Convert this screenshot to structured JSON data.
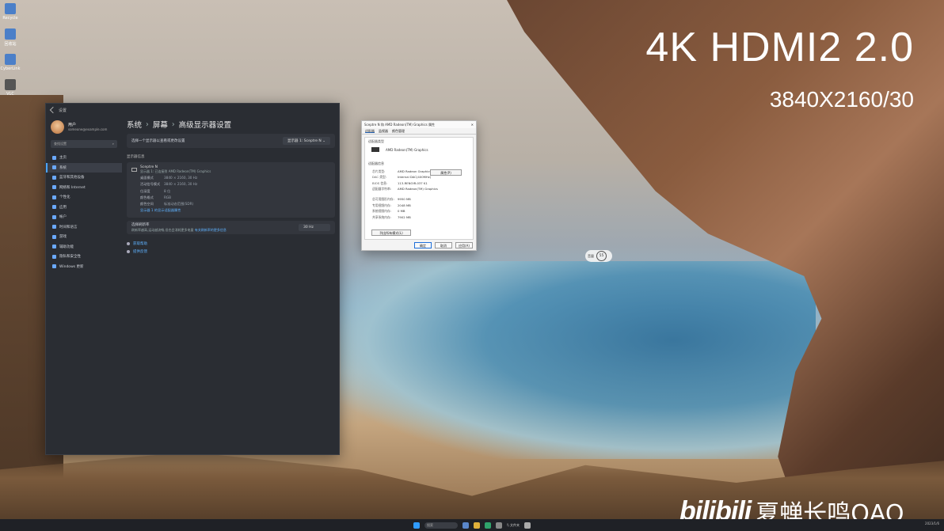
{
  "desktop": {
    "icons": [
      {
        "label": "Recycle",
        "icon": "recycle-bin-icon"
      },
      {
        "label": "回收站",
        "icon": "app-icon"
      },
      {
        "label": "CyberLink",
        "icon": "app-icon"
      },
      {
        "label": "VLC",
        "icon": "app-icon"
      }
    ]
  },
  "overlay": {
    "title": "4K HDMI2 2.0",
    "subtitle": "3840X2160/30",
    "watermark_logo": "bilibili",
    "watermark_name": "夏蝉长鸣QAQ"
  },
  "settings": {
    "window_title": "设置",
    "user": {
      "name": "用户",
      "email": "someone@example.com"
    },
    "find_placeholder": "查找设置",
    "nav": [
      {
        "label": "主页",
        "icon": "home-icon",
        "active": false
      },
      {
        "label": "系统",
        "icon": "system-icon",
        "active": true
      },
      {
        "label": "蓝牙和其他设备",
        "icon": "bluetooth-icon",
        "active": false
      },
      {
        "label": "网络和 Internet",
        "icon": "network-icon",
        "active": false
      },
      {
        "label": "个性化",
        "icon": "brush-icon",
        "active": false
      },
      {
        "label": "应用",
        "icon": "apps-icon",
        "active": false
      },
      {
        "label": "帐户",
        "icon": "account-icon",
        "active": false
      },
      {
        "label": "时间和语言",
        "icon": "clock-icon",
        "active": false
      },
      {
        "label": "游戏",
        "icon": "game-icon",
        "active": false
      },
      {
        "label": "辅助功能",
        "icon": "accessibility-icon",
        "active": false
      },
      {
        "label": "隐私和安全性",
        "icon": "shield-icon",
        "active": false
      },
      {
        "label": "Windows 更新",
        "icon": "update-icon",
        "active": false
      }
    ],
    "breadcrumb": [
      "系统",
      "屏幕",
      "高级显示器设置"
    ],
    "select_display_label": "选择一个显示器以查看或更改设置",
    "select_display_value": "显示器 1: Sceptre N",
    "display_info_heading": "显示器信息",
    "display_name": "Sceptre N",
    "display_sub": "显示器 1: 已连接到 AMD Radeon(TM) Graphics",
    "details": [
      {
        "k": "桌面模式",
        "v": "3840 × 2160, 30 Hz"
      },
      {
        "k": "活动信号模式",
        "v": "3840 × 2160, 30 Hz"
      },
      {
        "k": "位深度",
        "v": "8 位"
      },
      {
        "k": "颜色格式",
        "v": "RGB"
      },
      {
        "k": "颜色空间",
        "v": "标准动态范围(SDR)"
      }
    ],
    "adapter_link": "显示器 1 的显示适配器属性",
    "refresh_label": "选择刷新率",
    "refresh_desc": "刷新率越高,运动越流畅,但也会消耗更多电量",
    "refresh_link": "有关刷新率的更多信息",
    "refresh_value": "30 Hz",
    "help": [
      "获取帮助",
      "提供反馈"
    ]
  },
  "dialog": {
    "title": "Sceptre N 和 AMD Radeon(TM) Graphics 属性",
    "tabs": [
      "适配器",
      "监视器",
      "颜色管理"
    ],
    "adapter_group": "适配器类型",
    "adapter_name": "AMD Radeon(TM) Graphics",
    "properties_btn": "属性(P)",
    "info_group": "适配器信息",
    "info": [
      {
        "k": "芯片类型:",
        "v": "AMD Radeon Graphics Processor (0x1636)"
      },
      {
        "k": "DAC 类型:",
        "v": "Internal DAC(400MHz)"
      },
      {
        "k": "BIOS 信息:",
        "v": "113-RENOIR-037 K1"
      },
      {
        "k": "适配器字符串:",
        "v": "AMD Radeon(TM) Graphics"
      }
    ],
    "memory": [
      {
        "k": "总可用图形内存:",
        "v": "9950 MB"
      },
      {
        "k": "专用视频内存:",
        "v": "2048 MB"
      },
      {
        "k": "系统视频内存:",
        "v": "0 MB"
      },
      {
        "k": "共享系统内存:",
        "v": "7902 MB"
      }
    ],
    "list_modes_btn": "列出所有模式(L)",
    "ok": "确定",
    "cancel": "取消",
    "apply": "应用(A)"
  },
  "volume": {
    "percent": "55",
    "label": "音量"
  },
  "taskbar": {
    "search_placeholder": "搜索",
    "file": "\\\\ 文件夹",
    "tray": "2023/1/6"
  }
}
